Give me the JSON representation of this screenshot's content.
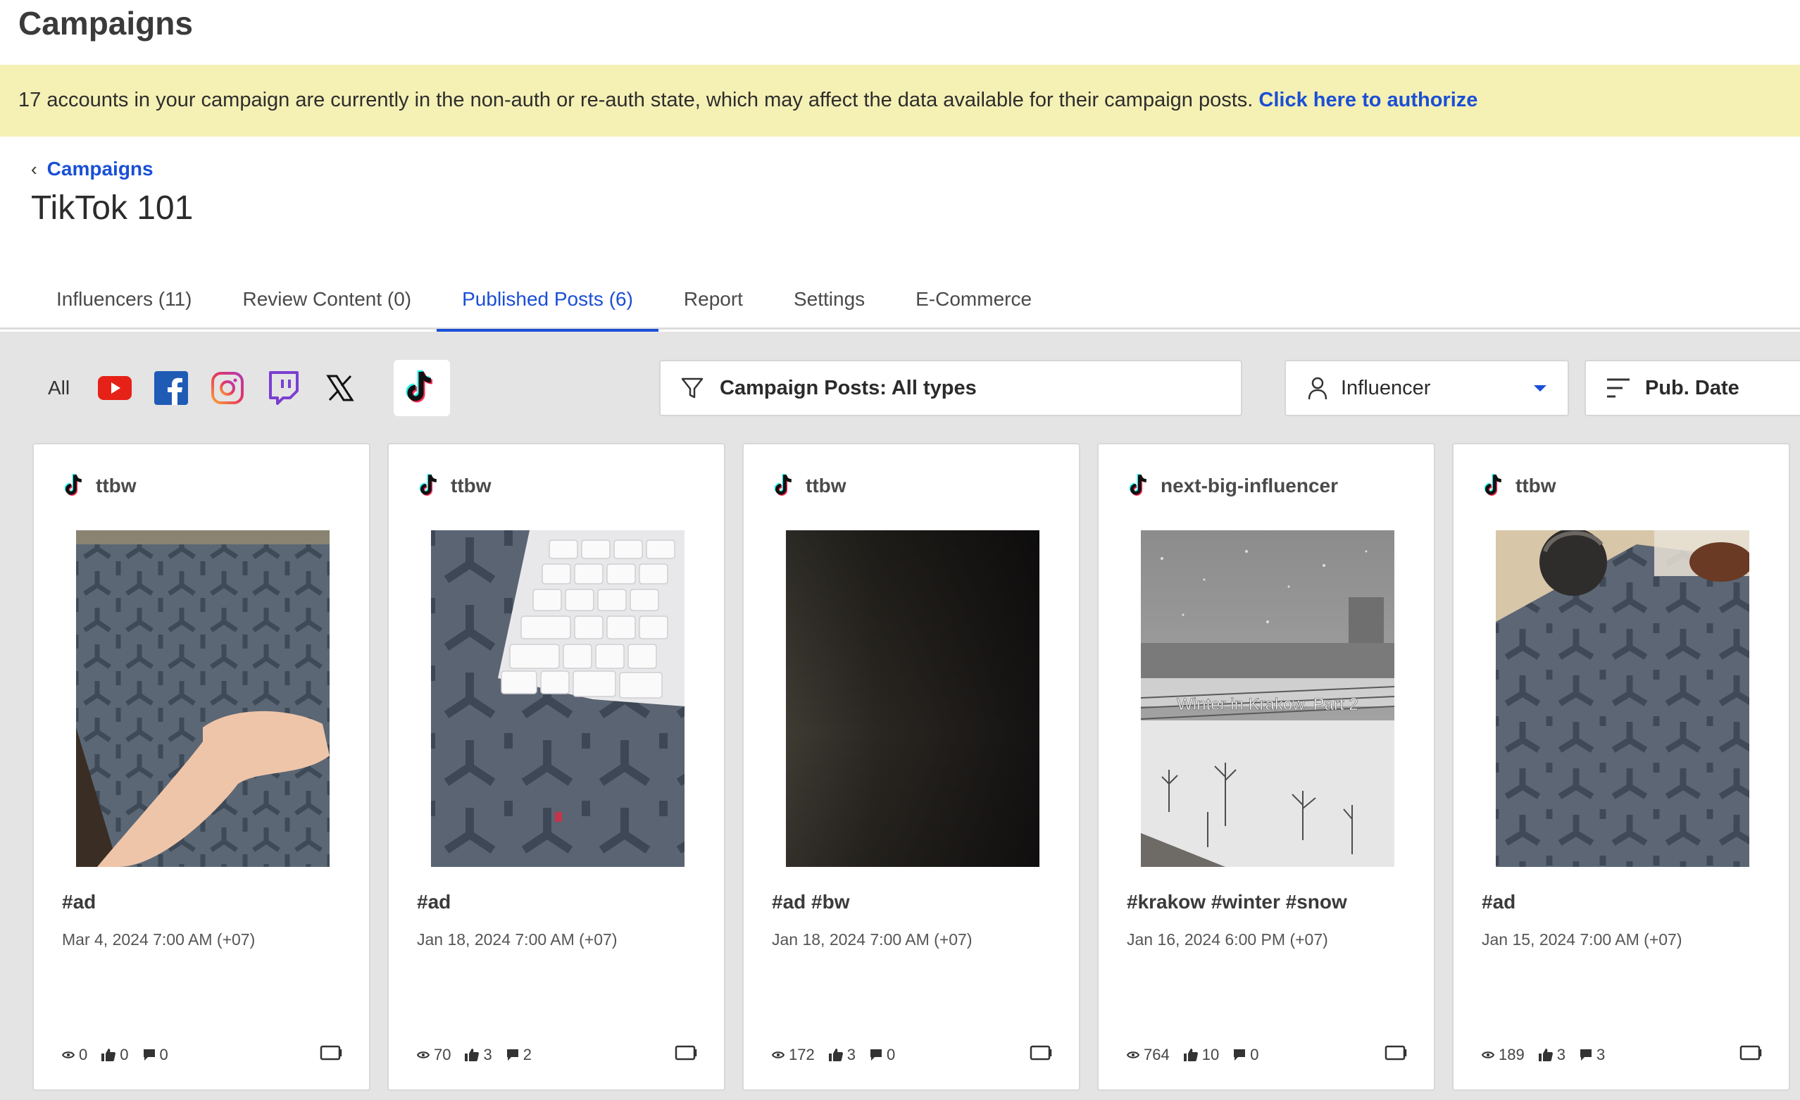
{
  "app": {
    "title": "Campaigns"
  },
  "banner": {
    "text": "17 accounts in your campaign are currently in the non-auth or re-auth state, which may affect the data available for their campaign posts. ",
    "link": "Click here to authorize"
  },
  "breadcrumb": {
    "label": "Campaigns"
  },
  "page": {
    "title": "TikTok 101"
  },
  "tabs": [
    {
      "label": "Influencers (11)"
    },
    {
      "label": "Review Content (0)"
    },
    {
      "label": "Published Posts (6)",
      "active": true
    },
    {
      "label": "Report"
    },
    {
      "label": "Settings"
    },
    {
      "label": "E-Commerce"
    }
  ],
  "platforms": {
    "all_label": "All",
    "items": [
      "youtube-icon",
      "facebook-icon",
      "instagram-icon",
      "twitch-icon",
      "x-icon",
      "tiktok-icon"
    ],
    "selected": "tiktok-icon"
  },
  "filter": {
    "label": "Campaign Posts: All types"
  },
  "influencer_dropdown": {
    "label": "Influencer"
  },
  "sort": {
    "label": "Pub. Date"
  },
  "colors": {
    "accent": "#1a4fd6",
    "banner_bg": "#f5f0b4",
    "content_bg": "#e4e4e4"
  },
  "posts": [
    {
      "username": "ttbw",
      "caption": "#ad",
      "date": "Mar 4, 2024 7:00 AM (+07)",
      "views": "0",
      "likes": "0",
      "comments": "0"
    },
    {
      "username": "ttbw",
      "caption": "#ad",
      "date": "Jan 18, 2024 7:00 AM (+07)",
      "views": "70",
      "likes": "3",
      "comments": "2"
    },
    {
      "username": "ttbw",
      "caption": "#ad #bw",
      "date": "Jan 18, 2024 7:00 AM (+07)",
      "views": "172",
      "likes": "3",
      "comments": "0"
    },
    {
      "username": "next-big-influencer",
      "caption": "#krakow #winter #snow",
      "date": "Jan 16, 2024 6:00 PM (+07)",
      "views": "764",
      "likes": "10",
      "comments": "0",
      "overlay_text": "Winter in Krakow. Part 2"
    },
    {
      "username": "ttbw",
      "caption": "#ad",
      "date": "Jan 15, 2024 7:00 AM (+07)",
      "views": "189",
      "likes": "3",
      "comments": "3"
    }
  ]
}
